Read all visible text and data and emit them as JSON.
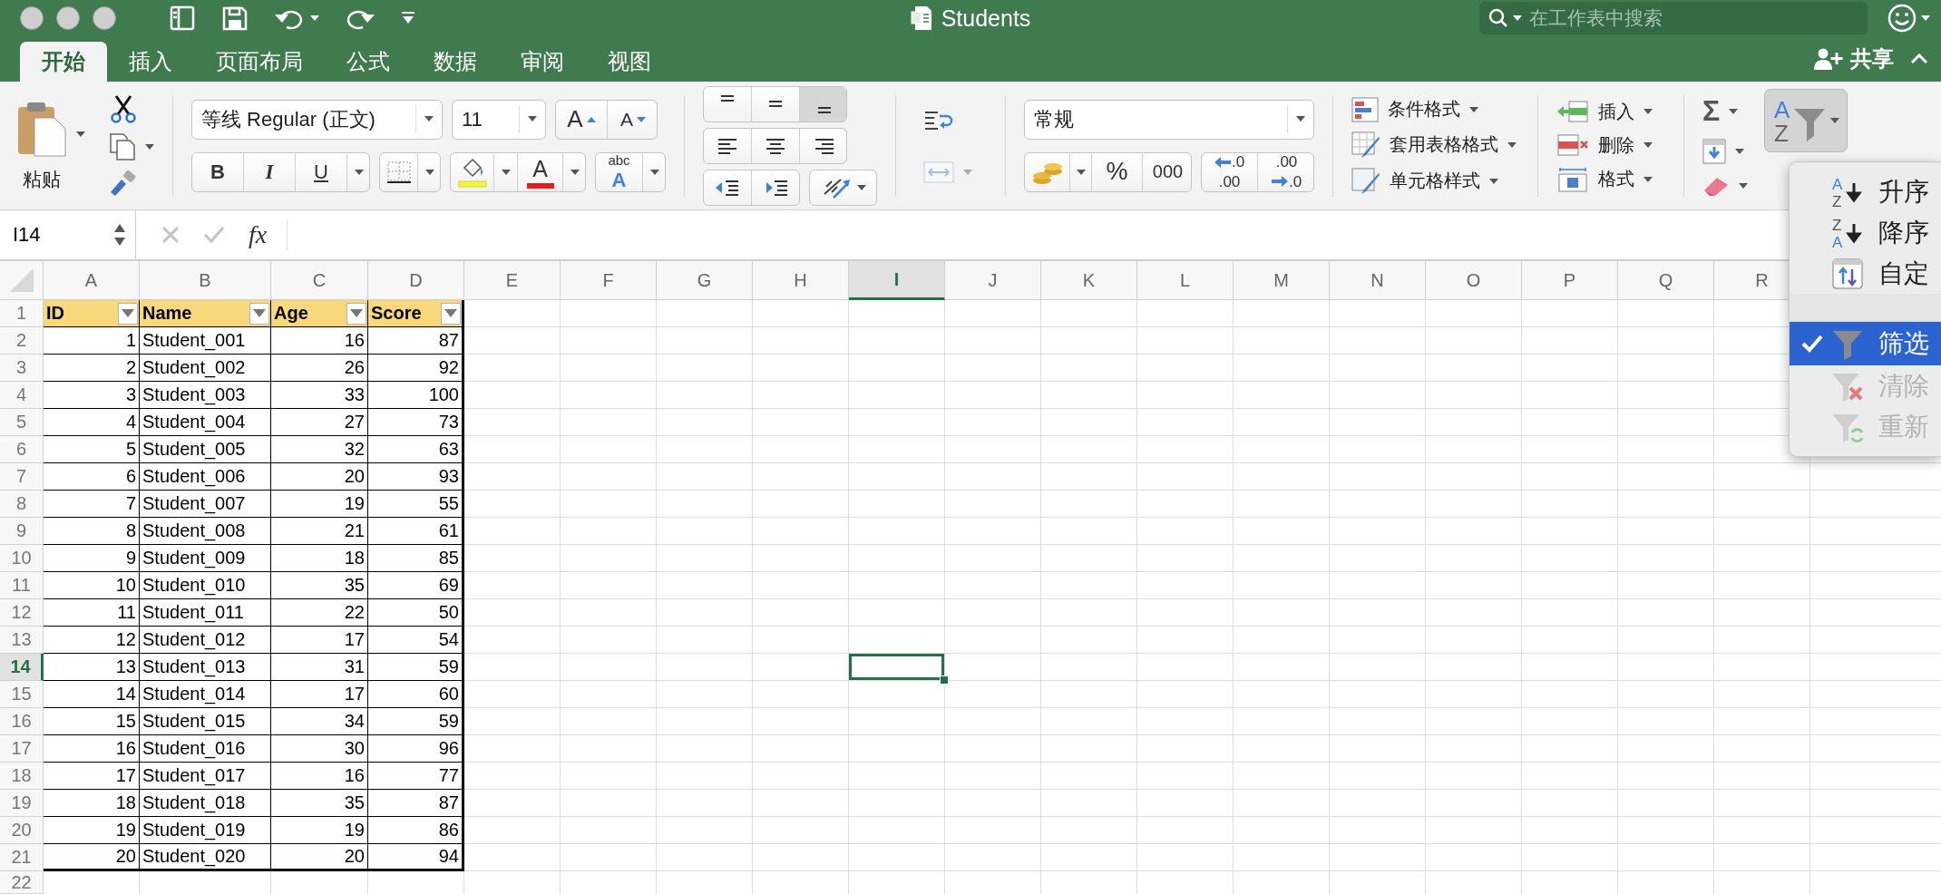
{
  "window": {
    "title": "Students",
    "search": {
      "placeholder": "在工作表中搜索"
    }
  },
  "tabs": [
    {
      "label": "开始",
      "selected": true
    },
    {
      "label": "插入",
      "selected": false
    },
    {
      "label": "页面布局",
      "selected": false
    },
    {
      "label": "公式",
      "selected": false
    },
    {
      "label": "数据",
      "selected": false
    },
    {
      "label": "审阅",
      "selected": false
    },
    {
      "label": "视图",
      "selected": false
    }
  ],
  "share": {
    "label": "共享"
  },
  "ribbon": {
    "paste": {
      "label": "粘贴"
    },
    "font": {
      "name": "等线 Regular (正文)",
      "size": "11",
      "grow": "A",
      "shrink": "A",
      "bold": "B",
      "italic": "I",
      "underline": "U",
      "color_letter": "A",
      "effects_top": "abc",
      "effects_bottom": "A"
    },
    "alignment": {
      "vertical": [
        {
          "selected": false
        },
        {
          "selected": false
        },
        {
          "selected": true
        }
      ],
      "merge": {
        "disabled": true
      }
    },
    "number": {
      "format": "常规",
      "percent": "%",
      "thousands": "000",
      "increase_decimal": [
        ".0",
        ".00"
      ],
      "decrease_decimal": [
        ".00",
        ".0"
      ]
    },
    "styles": [
      "条件格式",
      "套用表格格式",
      "单元格样式"
    ],
    "cells": [
      "插入",
      "删除",
      "格式"
    ],
    "editing": {
      "autosum": "Σ",
      "sort_filter": {
        "letters": [
          "A",
          "Z"
        ],
        "expanded": true
      }
    }
  },
  "formula_bar": {
    "name_box": "I14",
    "function_label": "fx"
  },
  "sheet": {
    "columns": [
      {
        "label": "A",
        "selected": false
      },
      {
        "label": "B",
        "selected": false
      },
      {
        "label": "C",
        "selected": false
      },
      {
        "label": "D",
        "selected": false
      },
      {
        "label": "E",
        "selected": false
      },
      {
        "label": "F",
        "selected": false
      },
      {
        "label": "G",
        "selected": false
      },
      {
        "label": "H",
        "selected": false
      },
      {
        "label": "I",
        "selected": true
      },
      {
        "label": "J",
        "selected": false
      },
      {
        "label": "K",
        "selected": false
      },
      {
        "label": "L",
        "selected": false
      },
      {
        "label": "M",
        "selected": false
      },
      {
        "label": "N",
        "selected": false
      },
      {
        "label": "O",
        "selected": false
      },
      {
        "label": "P",
        "selected": false
      },
      {
        "label": "Q",
        "selected": false
      },
      {
        "label": "R",
        "selected": false
      }
    ],
    "rows": [
      {
        "label": "1",
        "selected": false
      },
      {
        "label": "2",
        "selected": false
      },
      {
        "label": "3",
        "selected": false
      },
      {
        "label": "4",
        "selected": false
      },
      {
        "label": "5",
        "selected": false
      },
      {
        "label": "6",
        "selected": false
      },
      {
        "label": "7",
        "selected": false
      },
      {
        "label": "8",
        "selected": false
      },
      {
        "label": "9",
        "selected": false
      },
      {
        "label": "10",
        "selected": false
      },
      {
        "label": "11",
        "selected": false
      },
      {
        "label": "12",
        "selected": false
      },
      {
        "label": "13",
        "selected": false
      },
      {
        "label": "14",
        "selected": true
      },
      {
        "label": "15",
        "selected": false
      },
      {
        "label": "16",
        "selected": false
      },
      {
        "label": "17",
        "selected": false
      },
      {
        "label": "18",
        "selected": false
      },
      {
        "label": "19",
        "selected": false
      },
      {
        "label": "20",
        "selected": false
      },
      {
        "label": "21",
        "selected": false
      },
      {
        "label": "22",
        "selected": false
      }
    ],
    "table": {
      "columns": [
        {
          "label": "ID",
          "kind": "number"
        },
        {
          "label": "Name",
          "kind": "text"
        },
        {
          "label": "Age",
          "kind": "number"
        },
        {
          "label": "Score",
          "kind": "number"
        }
      ],
      "rows": [
        [
          "1",
          "Student_001",
          "16",
          "87"
        ],
        [
          "2",
          "Student_002",
          "26",
          "92"
        ],
        [
          "3",
          "Student_003",
          "33",
          "100"
        ],
        [
          "4",
          "Student_004",
          "27",
          "73"
        ],
        [
          "5",
          "Student_005",
          "32",
          "63"
        ],
        [
          "6",
          "Student_006",
          "20",
          "93"
        ],
        [
          "7",
          "Student_007",
          "19",
          "55"
        ],
        [
          "8",
          "Student_008",
          "21",
          "61"
        ],
        [
          "9",
          "Student_009",
          "18",
          "85"
        ],
        [
          "10",
          "Student_010",
          "35",
          "69"
        ],
        [
          "11",
          "Student_011",
          "22",
          "50"
        ],
        [
          "12",
          "Student_012",
          "17",
          "54"
        ],
        [
          "13",
          "Student_013",
          "31",
          "59"
        ],
        [
          "14",
          "Student_014",
          "17",
          "60"
        ],
        [
          "15",
          "Student_015",
          "34",
          "59"
        ],
        [
          "16",
          "Student_016",
          "30",
          "96"
        ],
        [
          "17",
          "Student_017",
          "16",
          "77"
        ],
        [
          "18",
          "Student_018",
          "35",
          "87"
        ],
        [
          "19",
          "Student_019",
          "19",
          "86"
        ],
        [
          "20",
          "Student_020",
          "20",
          "94"
        ]
      ]
    }
  },
  "sort_menu": {
    "groups": [
      [
        {
          "label": "升序",
          "kind": "sort-ascending",
          "letters": [
            "A",
            "Z"
          ],
          "checked": false,
          "disabled": false,
          "selected": false
        },
        {
          "label": "降序",
          "kind": "sort-descending",
          "letters": [
            "Z",
            "A"
          ],
          "checked": false,
          "disabled": false,
          "selected": false
        },
        {
          "label": "自定",
          "kind": "custom-sort",
          "checked": false,
          "disabled": false,
          "selected": false
        }
      ],
      [
        {
          "label": "筛选",
          "kind": "filter",
          "checked": true,
          "disabled": false,
          "selected": true
        },
        {
          "label": "清除",
          "kind": "clear-filter",
          "checked": false,
          "disabled": true,
          "selected": false
        },
        {
          "label": "重新",
          "kind": "reapply-filter",
          "checked": false,
          "disabled": true,
          "selected": false
        }
      ]
    ]
  }
}
